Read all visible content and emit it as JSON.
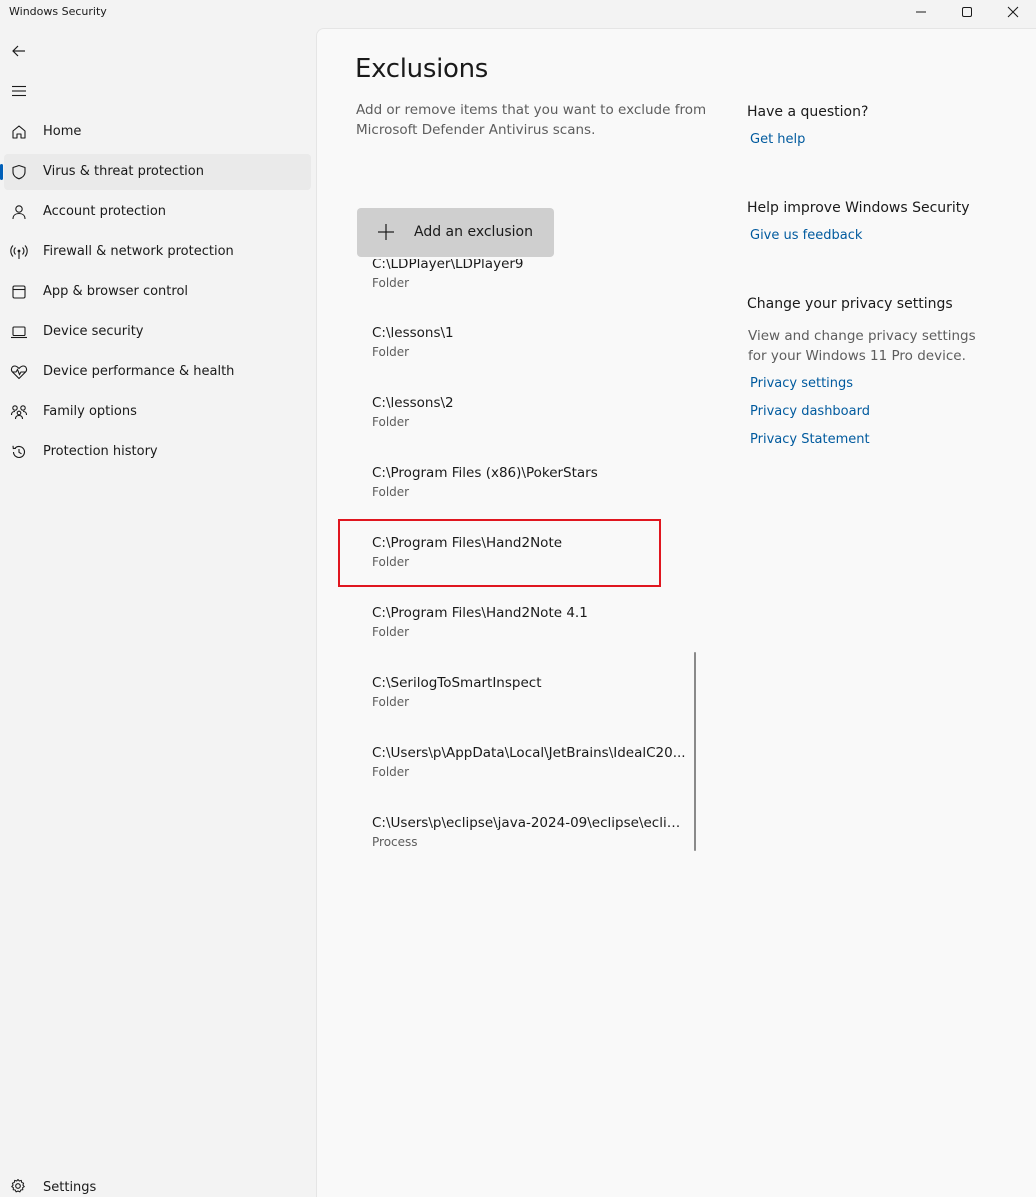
{
  "window": {
    "title": "Windows Security"
  },
  "sidebar": {
    "items": [
      {
        "label": "Home",
        "icon": "home-icon"
      },
      {
        "label": "Virus & threat protection",
        "icon": "shield-icon",
        "active": true
      },
      {
        "label": "Account protection",
        "icon": "person-icon"
      },
      {
        "label": "Firewall & network protection",
        "icon": "antenna-icon"
      },
      {
        "label": "App & browser control",
        "icon": "browser-window-icon"
      },
      {
        "label": "Device security",
        "icon": "laptop-icon"
      },
      {
        "label": "Device performance & health",
        "icon": "heart-pulse-icon"
      },
      {
        "label": "Family options",
        "icon": "family-icon"
      },
      {
        "label": "Protection history",
        "icon": "history-icon"
      }
    ],
    "settings_label": "Settings"
  },
  "main": {
    "title": "Exclusions",
    "description": "Add or remove items that you want to exclude from Microsoft Defender Antivirus scans.",
    "add_button_label": "Add an exclusion",
    "exclusions": [
      {
        "path": "C:\\LDPlayer\\LDPlayer9",
        "type": "Folder"
      },
      {
        "path": "C:\\lessons\\1",
        "type": "Folder"
      },
      {
        "path": "C:\\lessons\\2",
        "type": "Folder"
      },
      {
        "path": "C:\\Program Files (x86)\\PokerStars",
        "type": "Folder"
      },
      {
        "path": "C:\\Program Files\\Hand2Note",
        "type": "Folder",
        "highlighted": true
      },
      {
        "path": "C:\\Program Files\\Hand2Note 4.1",
        "type": "Folder"
      },
      {
        "path": "C:\\SerilogToSmartInspect",
        "type": "Folder"
      },
      {
        "path": "C:\\Users\\p\\AppData\\Local\\JetBrains\\IdealC20...",
        "type": "Folder"
      },
      {
        "path": "C:\\Users\\p\\eclipse\\java-2024-09\\eclipse\\eclip...",
        "type": "Process"
      }
    ]
  },
  "side_panel": {
    "question_heading": "Have a question?",
    "get_help": "Get help",
    "improve_heading": "Help improve Windows Security",
    "feedback": "Give us feedback",
    "privacy_heading": "Change your privacy settings",
    "privacy_text": "View and change privacy settings for your Windows 11 Pro device.",
    "privacy_settings": "Privacy settings",
    "privacy_dashboard": "Privacy dashboard",
    "privacy_statement": "Privacy Statement"
  },
  "colors": {
    "accent": "#005fb8",
    "link": "#005a9e",
    "highlight": "#e0161f"
  }
}
